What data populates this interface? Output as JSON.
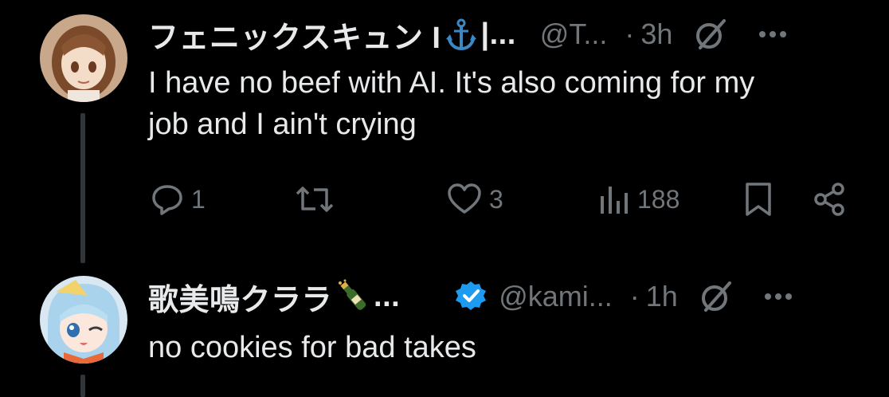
{
  "posts": [
    {
      "display_name": "フェニックスキュン I",
      "name_emoji": "⚓",
      "name_tail": "|...",
      "handle": "@T...",
      "separator": "·",
      "time": "3h",
      "text_line1": "I have no beef with AI. It's also coming for my",
      "text_line2": "job and I ain't crying",
      "actions": {
        "replies": "1",
        "reposts": "",
        "likes": "3",
        "views": "188"
      },
      "icons": [
        "avatar",
        "anchor-emoji",
        "grok-icon",
        "more-icon",
        "reply-icon",
        "repost-icon",
        "like-icon",
        "views-icon",
        "bookmark-icon",
        "share-icon"
      ]
    },
    {
      "display_name": "歌美鳴クララ",
      "name_emoji": "🍾",
      "name_tail": "...",
      "verified": true,
      "handle": "@kami...",
      "separator": "·",
      "time": "1h",
      "text_line1": "no cookies for bad takes",
      "icons": [
        "avatar",
        "champagne-emoji",
        "verified-badge-icon",
        "grok-icon",
        "more-icon"
      ]
    }
  ],
  "colors": {
    "background": "#000000",
    "text": "#e7e9ea",
    "muted": "#71767b",
    "verified": "#1d9bf0",
    "thread_line": "#333639"
  }
}
